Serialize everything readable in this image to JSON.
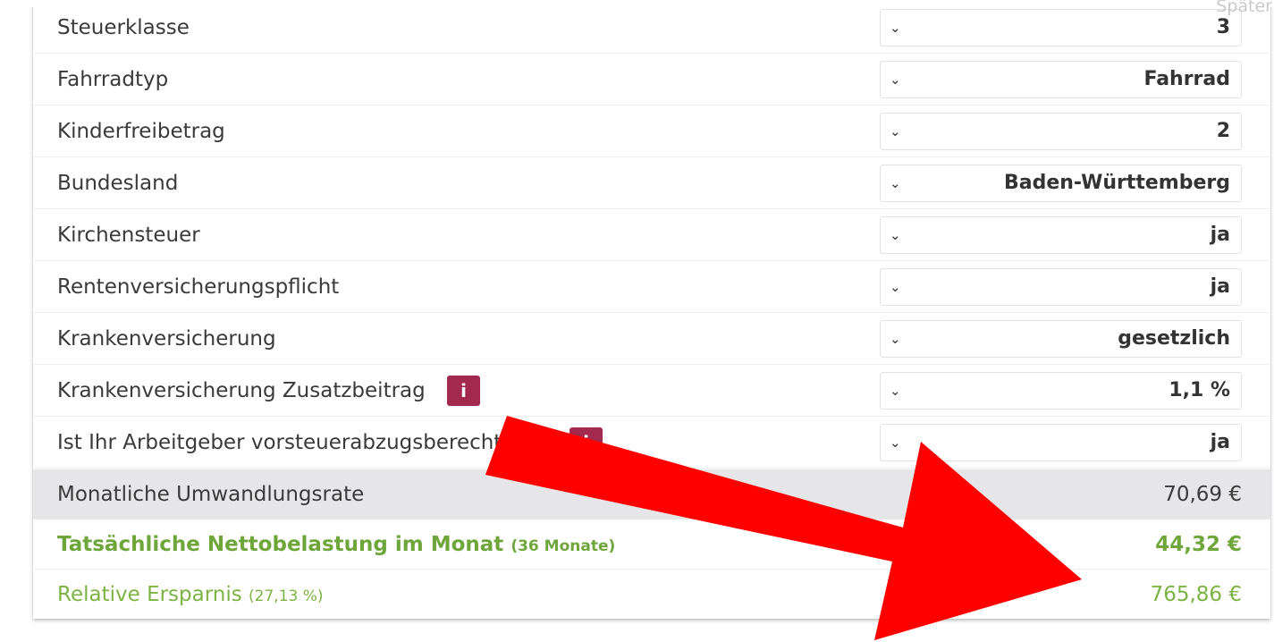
{
  "corner_text": "Später",
  "form_rows": [
    {
      "label": "Steuerklasse",
      "value": "3",
      "info": false
    },
    {
      "label": "Fahrradtyp",
      "value": "Fahrrad",
      "info": false
    },
    {
      "label": "Kinderfreibetrag",
      "value": "2",
      "info": false
    },
    {
      "label": "Bundesland",
      "value": "Baden-Württemberg",
      "info": false
    },
    {
      "label": "Kirchensteuer",
      "value": "ja",
      "info": false
    },
    {
      "label": "Rentenversicherungspflicht",
      "value": "ja",
      "info": false
    },
    {
      "label": "Krankenversicherung",
      "value": "gesetzlich",
      "info": false
    },
    {
      "label": "Krankenversicherung Zusatzbeitrag",
      "value": "1,1 %",
      "info": true
    },
    {
      "label": "Ist Ihr Arbeitgeber vorsteuerabzugsberechtigt?",
      "value": "ja",
      "info": true
    }
  ],
  "info_badge_text": "i",
  "chevron_glyph": "⌄",
  "summary": {
    "rate_label": "Monatliche Umwandlungsrate",
    "rate_value": "70,69 €",
    "net_label": "Tatsächliche Nettobelastung im Monat",
    "net_note": "(36 Monate)",
    "net_value": "44,32 €",
    "saving_label": "Relative Ersparnis",
    "saving_note": "(27,13 %)",
    "saving_value": "765,86 €"
  },
  "colors": {
    "info_badge": "#a4294f",
    "net_green": "#6fa63b",
    "saving_green": "#7cb342",
    "rate_row_bg": "#e6e6e8",
    "arrow_red": "#ff0000"
  }
}
